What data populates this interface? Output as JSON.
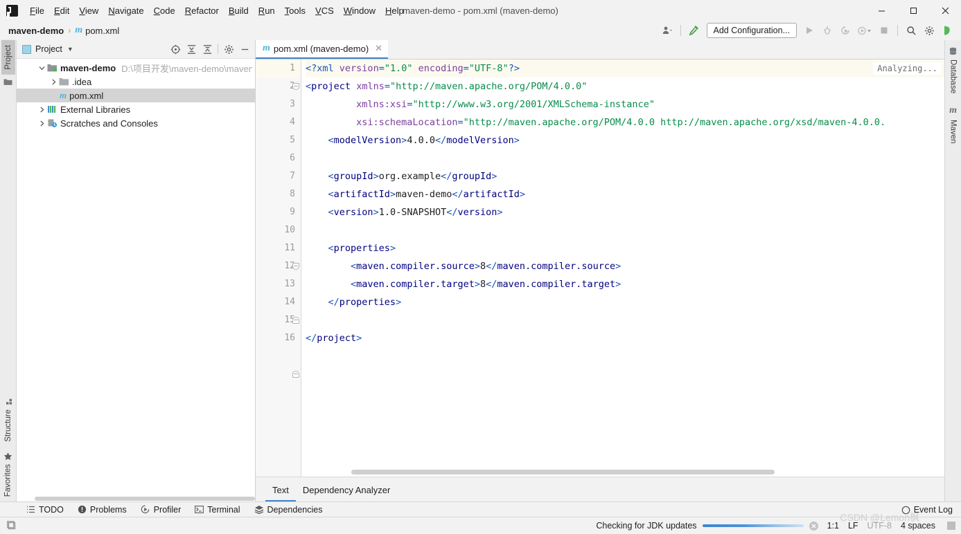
{
  "window": {
    "title": "maven-demo - pom.xml (maven-demo)",
    "minimize": "–",
    "maximize": "□",
    "close": "✕"
  },
  "menu": {
    "items": [
      {
        "label": "File"
      },
      {
        "label": "Edit"
      },
      {
        "label": "View"
      },
      {
        "label": "Navigate"
      },
      {
        "label": "Code"
      },
      {
        "label": "Refactor"
      },
      {
        "label": "Build"
      },
      {
        "label": "Run"
      },
      {
        "label": "Tools"
      },
      {
        "label": "VCS"
      },
      {
        "label": "Window"
      },
      {
        "label": "Help"
      }
    ]
  },
  "navbar": {
    "breadcrumb": [
      {
        "label": "maven-demo",
        "icon": ""
      },
      {
        "label": "pom.xml",
        "icon": "maven-m-icon"
      }
    ],
    "separator": "›",
    "add_configuration": "Add Configuration..."
  },
  "left_stripe": {
    "top": [
      {
        "label": "Project",
        "active": true
      }
    ],
    "bottom": [
      {
        "label": "Structure"
      },
      {
        "label": "Favorites"
      }
    ]
  },
  "right_stripe": {
    "items": [
      {
        "label": "Database"
      },
      {
        "label": "Maven"
      }
    ]
  },
  "project_panel": {
    "title": "Project",
    "tree": [
      {
        "label": "maven-demo",
        "path": "D:\\项目开发\\maven-demo\\maven-dem",
        "bold": true,
        "expanded": true,
        "depth": 0,
        "icon": "module-icon"
      },
      {
        "label": ".idea",
        "path": "",
        "bold": false,
        "expanded": false,
        "depth": 1,
        "icon": "folder-icon"
      },
      {
        "label": "pom.xml",
        "path": "",
        "bold": false,
        "expanded": null,
        "depth": 1,
        "icon": "maven-file-icon",
        "selected": true
      },
      {
        "label": "External Libraries",
        "path": "",
        "bold": false,
        "expanded": false,
        "depth": 0,
        "icon": "libraries-icon"
      },
      {
        "label": "Scratches and Consoles",
        "path": "",
        "bold": false,
        "expanded": false,
        "depth": 0,
        "icon": "scratches-icon"
      }
    ]
  },
  "editor": {
    "tab_label": "pom.xml (maven-demo)",
    "tab_close": "✕",
    "analyzing": "Analyzing...",
    "line_numbers": [
      1,
      2,
      3,
      4,
      5,
      6,
      7,
      8,
      9,
      10,
      11,
      12,
      13,
      14,
      15,
      16
    ],
    "current_line": 1,
    "lines": [
      {
        "n": 1,
        "tokens": [
          {
            "t": "<?",
            "c": "punct"
          },
          {
            "t": "xml",
            "c": "pi"
          },
          {
            "t": " ",
            "c": "txt"
          },
          {
            "t": "version",
            "c": "attr"
          },
          {
            "t": "=",
            "c": "punct"
          },
          {
            "t": "\"1.0\"",
            "c": "val"
          },
          {
            "t": " ",
            "c": "txt"
          },
          {
            "t": "encoding",
            "c": "attr"
          },
          {
            "t": "=",
            "c": "punct"
          },
          {
            "t": "\"UTF-8\"",
            "c": "val"
          },
          {
            "t": "?>",
            "c": "punct"
          }
        ]
      },
      {
        "n": 2,
        "tokens": [
          {
            "t": "<",
            "c": "punct"
          },
          {
            "t": "project",
            "c": "tagname"
          },
          {
            "t": " ",
            "c": "txt"
          },
          {
            "t": "xmlns",
            "c": "attr"
          },
          {
            "t": "=",
            "c": "punct"
          },
          {
            "t": "\"http://maven.apache.org/POM/4.0.0\"",
            "c": "val"
          }
        ]
      },
      {
        "n": 3,
        "tokens": [
          {
            "t": "         ",
            "c": "txt"
          },
          {
            "t": "xmlns:xsi",
            "c": "attr"
          },
          {
            "t": "=",
            "c": "punct"
          },
          {
            "t": "\"http://www.w3.org/2001/XMLSchema-instance\"",
            "c": "val"
          }
        ]
      },
      {
        "n": 4,
        "tokens": [
          {
            "t": "         ",
            "c": "txt"
          },
          {
            "t": "xsi:schemaLocation",
            "c": "attr"
          },
          {
            "t": "=",
            "c": "punct"
          },
          {
            "t": "\"http://maven.apache.org/POM/4.0.0 http://maven.apache.org/xsd/maven-4.0.0.",
            "c": "val"
          }
        ]
      },
      {
        "n": 5,
        "tokens": [
          {
            "t": "    ",
            "c": "txt"
          },
          {
            "t": "<",
            "c": "punct"
          },
          {
            "t": "modelVersion",
            "c": "tagname"
          },
          {
            "t": ">",
            "c": "punct"
          },
          {
            "t": "4.0.0",
            "c": "txt"
          },
          {
            "t": "</",
            "c": "punct"
          },
          {
            "t": "modelVersion",
            "c": "tagname"
          },
          {
            "t": ">",
            "c": "punct"
          }
        ]
      },
      {
        "n": 6,
        "tokens": []
      },
      {
        "n": 7,
        "tokens": [
          {
            "t": "    ",
            "c": "txt"
          },
          {
            "t": "<",
            "c": "punct"
          },
          {
            "t": "groupId",
            "c": "tagname"
          },
          {
            "t": ">",
            "c": "punct"
          },
          {
            "t": "org.example",
            "c": "txt"
          },
          {
            "t": "</",
            "c": "punct"
          },
          {
            "t": "groupId",
            "c": "tagname"
          },
          {
            "t": ">",
            "c": "punct"
          }
        ]
      },
      {
        "n": 8,
        "tokens": [
          {
            "t": "    ",
            "c": "txt"
          },
          {
            "t": "<",
            "c": "punct"
          },
          {
            "t": "artifactId",
            "c": "tagname"
          },
          {
            "t": ">",
            "c": "punct"
          },
          {
            "t": "maven-demo",
            "c": "txt"
          },
          {
            "t": "</",
            "c": "punct"
          },
          {
            "t": "artifactId",
            "c": "tagname"
          },
          {
            "t": ">",
            "c": "punct"
          }
        ]
      },
      {
        "n": 9,
        "tokens": [
          {
            "t": "    ",
            "c": "txt"
          },
          {
            "t": "<",
            "c": "punct"
          },
          {
            "t": "version",
            "c": "tagname"
          },
          {
            "t": ">",
            "c": "punct"
          },
          {
            "t": "1.0-SNAPSHOT",
            "c": "txt"
          },
          {
            "t": "</",
            "c": "punct"
          },
          {
            "t": "version",
            "c": "tagname"
          },
          {
            "t": ">",
            "c": "punct"
          }
        ]
      },
      {
        "n": 10,
        "tokens": []
      },
      {
        "n": 11,
        "tokens": [
          {
            "t": "    ",
            "c": "txt"
          },
          {
            "t": "<",
            "c": "punct"
          },
          {
            "t": "properties",
            "c": "tagname"
          },
          {
            "t": ">",
            "c": "punct"
          }
        ]
      },
      {
        "n": 12,
        "tokens": [
          {
            "t": "        ",
            "c": "txt"
          },
          {
            "t": "<",
            "c": "punct"
          },
          {
            "t": "maven.compiler.source",
            "c": "tagname"
          },
          {
            "t": ">",
            "c": "punct"
          },
          {
            "t": "8",
            "c": "txt"
          },
          {
            "t": "</",
            "c": "punct"
          },
          {
            "t": "maven.compiler.source",
            "c": "tagname"
          },
          {
            "t": ">",
            "c": "punct"
          }
        ]
      },
      {
        "n": 13,
        "tokens": [
          {
            "t": "        ",
            "c": "txt"
          },
          {
            "t": "<",
            "c": "punct"
          },
          {
            "t": "maven.compiler.target",
            "c": "tagname"
          },
          {
            "t": ">",
            "c": "punct"
          },
          {
            "t": "8",
            "c": "txt"
          },
          {
            "t": "</",
            "c": "punct"
          },
          {
            "t": "maven.compiler.target",
            "c": "tagname"
          },
          {
            "t": ">",
            "c": "punct"
          }
        ]
      },
      {
        "n": 14,
        "tokens": [
          {
            "t": "    ",
            "c": "txt"
          },
          {
            "t": "</",
            "c": "punct"
          },
          {
            "t": "properties",
            "c": "tagname"
          },
          {
            "t": ">",
            "c": "punct"
          }
        ]
      },
      {
        "n": 15,
        "tokens": []
      },
      {
        "n": 16,
        "tokens": [
          {
            "t": "</",
            "c": "punct"
          },
          {
            "t": "project",
            "c": "tagname"
          },
          {
            "t": ">",
            "c": "punct"
          }
        ]
      }
    ]
  },
  "bottom_tabs": [
    {
      "label": "Text",
      "active": true
    },
    {
      "label": "Dependency Analyzer",
      "active": false
    }
  ],
  "tool_window_bar": [
    {
      "label": "TODO",
      "icon": "todo-icon"
    },
    {
      "label": "Problems",
      "icon": "problems-icon"
    },
    {
      "label": "Profiler",
      "icon": "profiler-icon"
    },
    {
      "label": "Terminal",
      "icon": "terminal-icon"
    },
    {
      "label": "Dependencies",
      "icon": "dependencies-icon"
    }
  ],
  "status_bar": {
    "progress_text": "Checking for JDK updates",
    "cancel": "✕",
    "caret_position": "1:1",
    "line_separator": "LF",
    "encoding": "UTF-8",
    "indent": "4 spaces",
    "event_log": "Event Log",
    "watermark": "CSDN @Lemon枫"
  },
  "colors": {
    "accent": "#4083c9",
    "tag": "#000080",
    "punct": "#1a53b8",
    "attr": "#7a3e9d",
    "value": "#088c4a",
    "maven_blue": "#4fb3d9",
    "selection": "#d4d4d4"
  }
}
